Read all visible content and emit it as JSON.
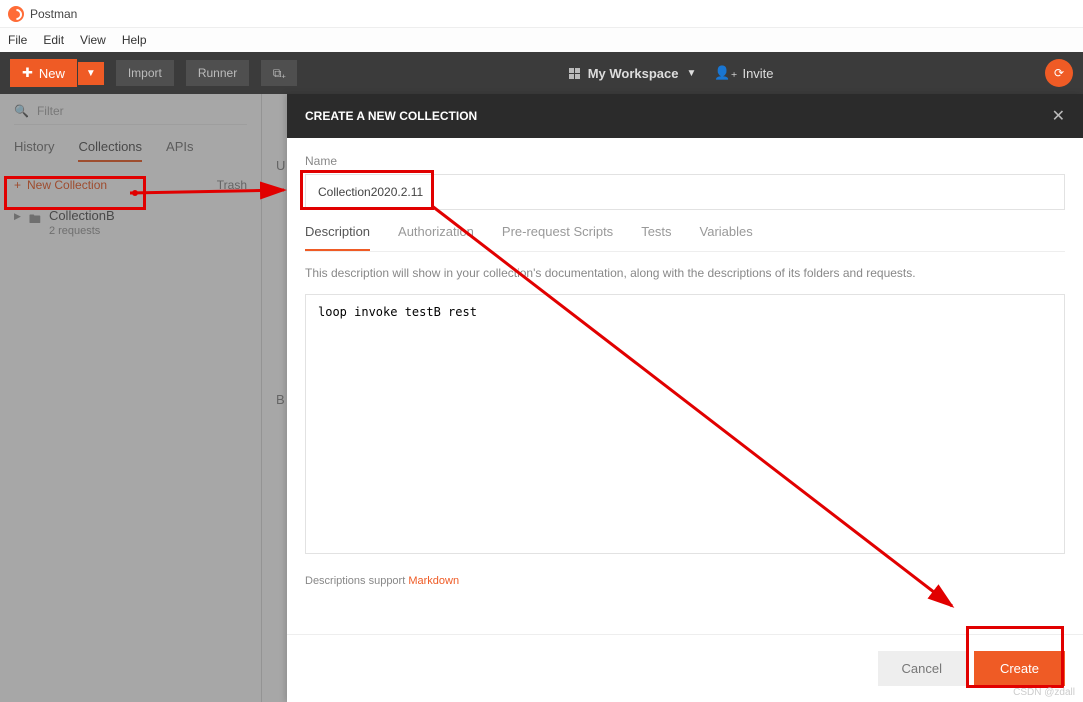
{
  "app": {
    "title": "Postman"
  },
  "menu": {
    "file": "File",
    "edit": "Edit",
    "view": "View",
    "help": "Help"
  },
  "toolbar": {
    "new": "New",
    "import": "Import",
    "runner": "Runner",
    "workspace": "My Workspace",
    "invite": "Invite"
  },
  "sidebar": {
    "filter_placeholder": "Filter",
    "tabs": {
      "history": "History",
      "collections": "Collections",
      "apis": "APIs"
    },
    "new_collection": "New Collection",
    "trash": "Trash",
    "item": {
      "name": "CollectionB",
      "sub": "2 requests"
    }
  },
  "modal": {
    "title": "CREATE A NEW COLLECTION",
    "name_label": "Name",
    "name_value": "Collection2020.2.11",
    "tabs": {
      "description": "Description",
      "authorization": "Authorization",
      "prerequest": "Pre-request Scripts",
      "tests": "Tests",
      "variables": "Variables"
    },
    "helper": "This description will show in your collection's documentation, along with the descriptions of its folders and requests.",
    "description_value": "loop invoke testB rest",
    "md_prefix": "Descriptions support ",
    "md_link": "Markdown",
    "cancel": "Cancel",
    "create": "Create"
  },
  "watermark": "CSDN @zdall",
  "hidden": {
    "u": "U",
    "b": "B"
  }
}
